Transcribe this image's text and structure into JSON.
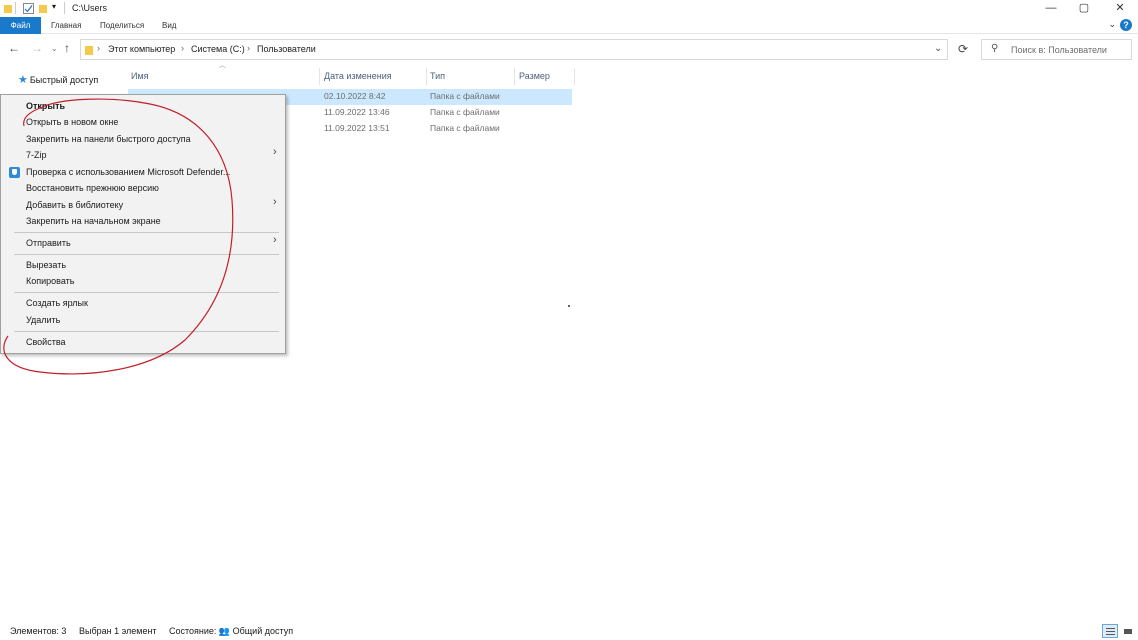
{
  "window": {
    "title": "C:\\Users",
    "minimize_icon": "—",
    "maximize_icon": "▢",
    "close_icon": "✕"
  },
  "ribbon": {
    "tabs": [
      "Файл",
      "Главная",
      "Поделиться",
      "Вид"
    ],
    "expand_icon": "⌄",
    "help_icon": "?"
  },
  "address_bar": {
    "crumbs": [
      "Этот компьютер",
      "Система (C:)",
      "Пользователи"
    ],
    "dropdown_icon": "⌄",
    "refresh_icon": "⟳"
  },
  "search": {
    "placeholder": "Поиск в: Пользователи",
    "icon": "⚲"
  },
  "nav_pane": {
    "quick_access": "Быстрый доступ"
  },
  "columns": [
    "Имя",
    "Дата изменения",
    "Тип",
    "Размер"
  ],
  "rows": [
    {
      "date": "02.10.2022 8:42",
      "type": "Папка с файлами",
      "selected": true
    },
    {
      "date": "11.09.2022 13:46",
      "type": "Папка с файлами",
      "selected": false
    },
    {
      "date": "11.09.2022 13:51",
      "type": "Папка с файлами",
      "selected": false
    }
  ],
  "context_menu": {
    "items": [
      "Открыть",
      "Открыть в новом окне",
      "Закрепить на панели быстрого доступа",
      "7-Zip",
      "Проверка с использованием Microsoft Defender...",
      "Восстановить прежнюю версию",
      "Добавить в библиотеку",
      "Закрепить на начальном экране",
      "Отправить",
      "Вырезать",
      "Копировать",
      "Создать ярлык",
      "Удалить",
      "Свойства"
    ],
    "submenu_arrow": "›"
  },
  "status_bar": {
    "count": "Элементов: 3",
    "selected": "Выбран 1 элемент",
    "state": "Состояние: 👥 Общий доступ"
  },
  "colors": {
    "accent": "#1979ca",
    "selection": "#cce8ff",
    "annotation": "#c0202a"
  }
}
